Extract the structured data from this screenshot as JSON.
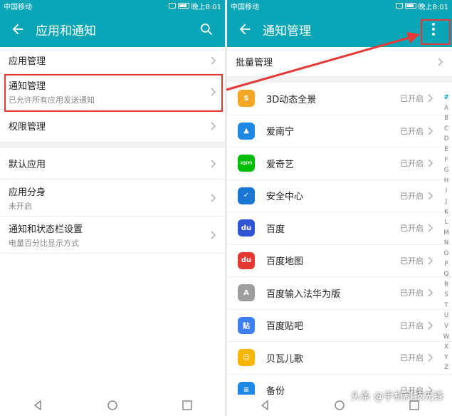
{
  "left": {
    "status": {
      "carrier": "中国移动",
      "time": "晚上8:01"
    },
    "appbar": {
      "title": "应用和通知"
    },
    "rows": [
      {
        "title": "应用管理",
        "sub": ""
      },
      {
        "title": "通知管理",
        "sub": "已允许所有应用发送通知"
      },
      {
        "title": "权限管理",
        "sub": ""
      },
      {
        "title": "默认应用",
        "sub": ""
      },
      {
        "title": "应用分身",
        "sub": "未开启"
      },
      {
        "title": "通知和状态栏设置",
        "sub": "电量百分比显示方式"
      }
    ]
  },
  "right": {
    "status": {
      "carrier": "中国移动",
      "time": "晚上8:01"
    },
    "appbar": {
      "title": "通知管理"
    },
    "batch": "批量管理",
    "apps": [
      {
        "name": "3D动态全景",
        "status": "已开启",
        "icon": "app-3d-icon",
        "color": "#f5a623",
        "glyph": "S"
      },
      {
        "name": "爱南宁",
        "status": "已开启",
        "icon": "app-ainanning-icon",
        "color": "#1e88e5",
        "glyph": "▲"
      },
      {
        "name": "爱奇艺",
        "status": "已开启",
        "icon": "app-iqiyi-icon",
        "color": "#00be06",
        "glyph": "iQIYI"
      },
      {
        "name": "安全中心",
        "status": "已开启",
        "icon": "app-security-icon",
        "color": "#1976d2",
        "glyph": "✓"
      },
      {
        "name": "百度",
        "status": "已开启",
        "icon": "app-baidu-icon",
        "color": "#2f55d4",
        "glyph": "du"
      },
      {
        "name": "百度地图",
        "status": "已开启",
        "icon": "app-baidu-map-icon",
        "color": "#e53935",
        "glyph": "du"
      },
      {
        "name": "百度输入法华为版",
        "status": "已开启",
        "icon": "app-baidu-ime-icon",
        "color": "#9e9e9e",
        "glyph": "A"
      },
      {
        "name": "百度贴吧",
        "status": "已开启",
        "icon": "app-tieba-icon",
        "color": "#3d7ff2",
        "glyph": "贴"
      },
      {
        "name": "贝瓦儿歌",
        "status": "已开启",
        "icon": "app-beiwa-icon",
        "color": "#f7b500",
        "glyph": "☺"
      },
      {
        "name": "备份",
        "status": "已开启",
        "icon": "app-backup-icon",
        "color": "#1e88e5",
        "glyph": "≡"
      }
    ],
    "index": [
      "#",
      "A",
      "B",
      "C",
      "D",
      "E",
      "F",
      "G",
      "H",
      "I",
      "J",
      "K",
      "L",
      "M",
      "N",
      "O",
      "P",
      "Q",
      "R",
      "S",
      "T",
      "U",
      "V",
      "W",
      "X",
      "Y",
      "Z"
    ]
  },
  "watermark": "头条 @手机科技先锋",
  "colors": {
    "accent": "#0aa6b8",
    "highlight": "#e53935"
  }
}
